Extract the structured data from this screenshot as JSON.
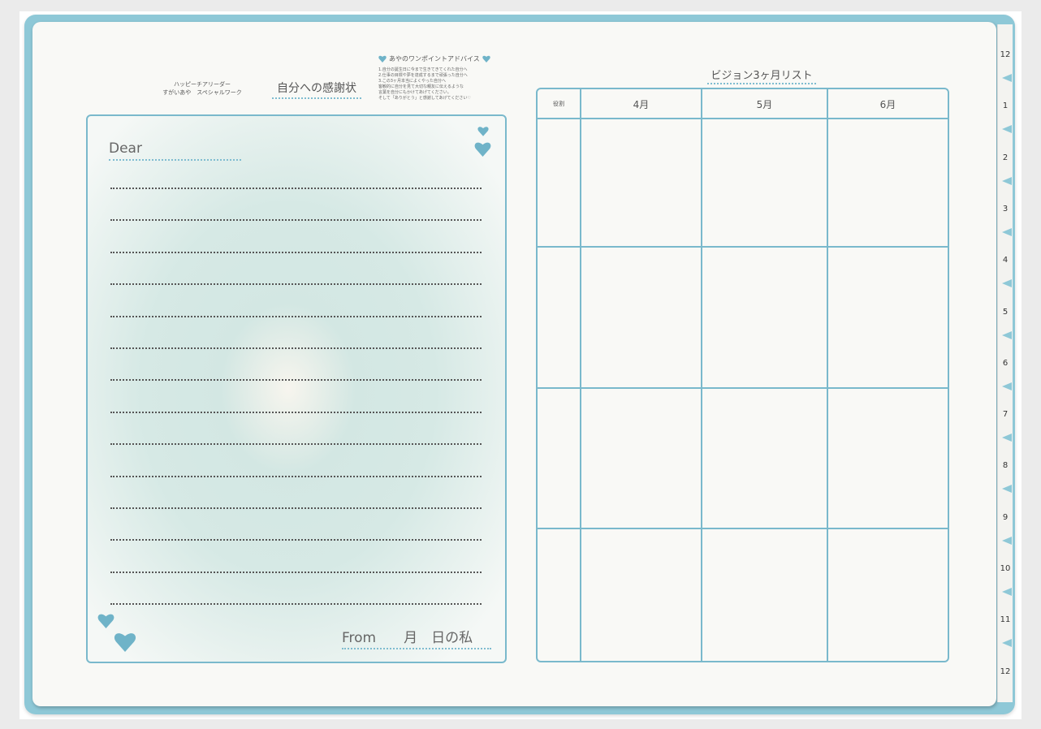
{
  "header": {
    "subtitle_line1": "ハッピーチアリーダー",
    "subtitle_line2": "すがいあや　スペシャルワーク",
    "letter_title": "自分への感謝状"
  },
  "advice": {
    "title": "あやのワンポイントアドバイス",
    "lines": [
      "1.自分の誕生日に今まで生きてきてくれた自分へ",
      "2.仕事の目標や夢を達成するまで頑張った自分へ",
      "3.この3ヶ月本当によくやった自分へ",
      "客観的に自分を見て大切な親友に伝えるような",
      "言葉を自分にもかけてあげてください。",
      "そして「ありがとう」と感謝してあげてください♡"
    ]
  },
  "letter": {
    "dear_label": "Dear",
    "from_label": "From　　月　日の私",
    "rule_count": 14
  },
  "vision": {
    "title": "ビジョン3ヶ月リスト",
    "role_header": "役割",
    "months": [
      "4月",
      "5月",
      "6月"
    ],
    "row_count": 4
  },
  "tabs": [
    "12",
    "1",
    "2",
    "3",
    "4",
    "5",
    "6",
    "7",
    "8",
    "9",
    "10",
    "11",
    "12"
  ],
  "colors": {
    "accent": "#7ab9cc",
    "cover": "#8ec8d7",
    "page": "#f9f9f6"
  }
}
